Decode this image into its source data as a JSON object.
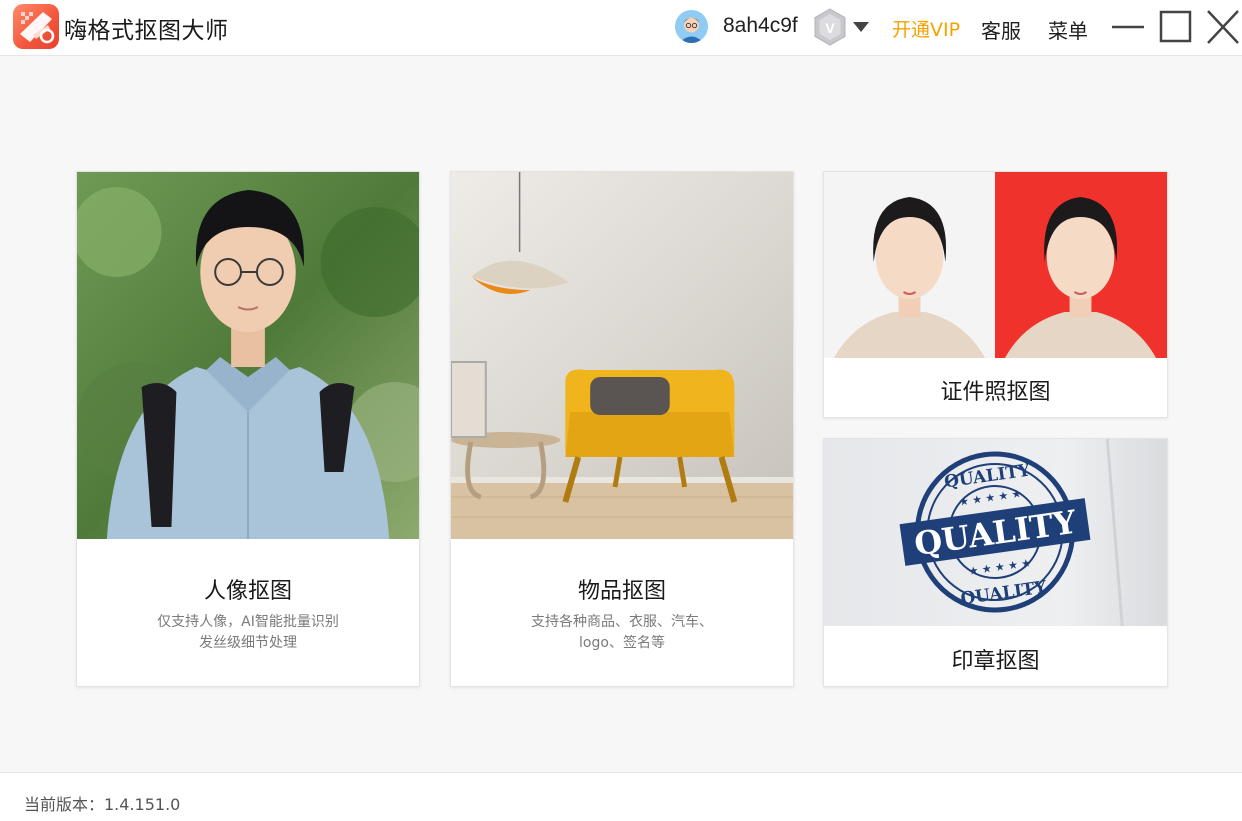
{
  "app": {
    "title": "嗨格式抠图大师",
    "logo_icon": "scissors-logo-icon",
    "brand_color": "#f2553c"
  },
  "header": {
    "username": "8ah4c9f",
    "avatar_icon": "user-avatar-icon",
    "vip_badge_icon": "vip-shield-badge-icon",
    "vip_badge_letter": "V",
    "open_vip_label": "开通VIP",
    "open_vip_color": "#f5a200",
    "service_label": "客服",
    "menu_label": "菜单"
  },
  "window_controls": {
    "minimize_icon": "minimize-icon",
    "maximize_icon": "maximize-icon",
    "close_icon": "close-icon"
  },
  "cards": {
    "portrait": {
      "title": "人像抠图",
      "desc_line1": "仅支持人像，AI智能批量识别",
      "desc_line2": "发丝级细节处理"
    },
    "object": {
      "title": "物品抠图",
      "desc_line1": "支持各种商品、衣服、汽车、",
      "desc_line2": "logo、签名等"
    },
    "id_photo": {
      "title": "证件照抠图"
    },
    "seal": {
      "title": "印章抠图",
      "stamp_text_top": "QUALITY",
      "stamp_text_main": "QUALITY",
      "stamp_text_bottom": "QUALITY",
      "stamp_color": "#1f3f78"
    }
  },
  "footer": {
    "version_label": "当前版本：1.4.151.0"
  }
}
